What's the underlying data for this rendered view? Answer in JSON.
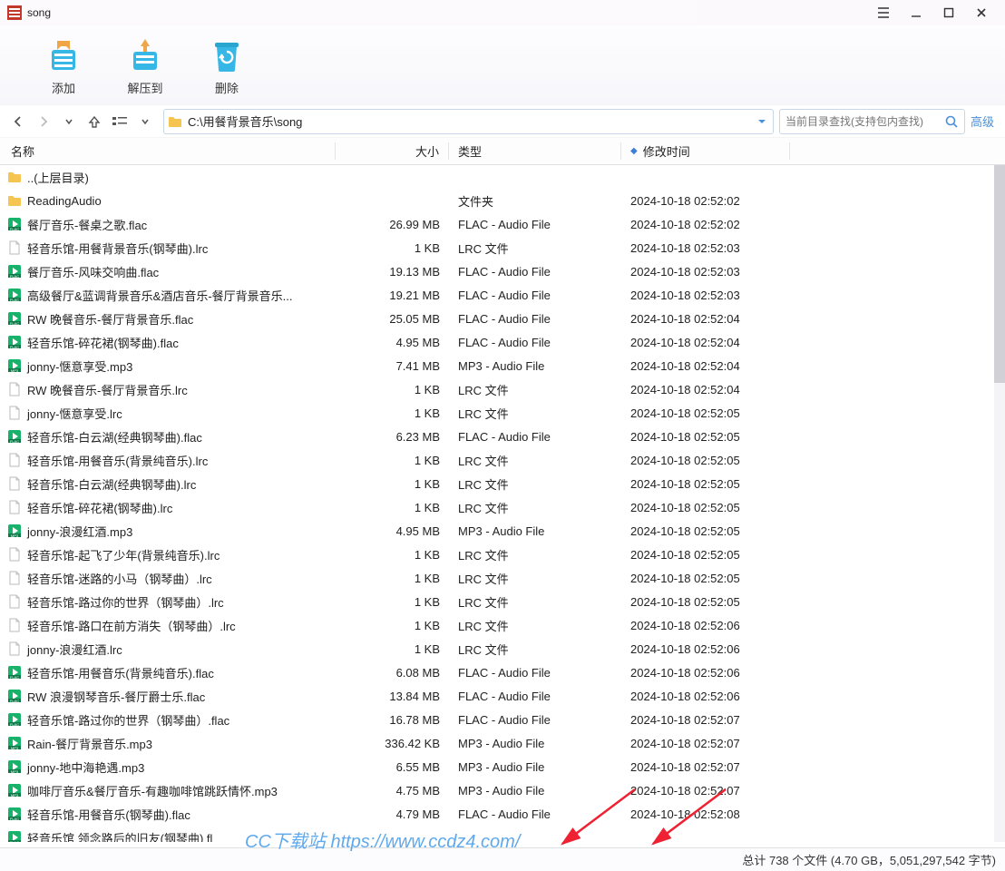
{
  "title": "song",
  "toolbar": {
    "add": "添加",
    "extract": "解压到",
    "delete": "删除"
  },
  "path": "C:\\用餐背景音乐\\song",
  "search_placeholder": "当前目录查找(支持包内查找)",
  "advanced": "高级",
  "columns": {
    "name": "名称",
    "size": "大小",
    "type": "类型",
    "date": "修改时间"
  },
  "files": [
    {
      "icon": "folder-up",
      "name": "..(上层目录)",
      "size": "",
      "type": "",
      "date": ""
    },
    {
      "icon": "folder",
      "name": "ReadingAudio",
      "size": "",
      "type": "文件夹",
      "date": "2024-10-18 02:52:02"
    },
    {
      "icon": "flac",
      "name": "餐厅音乐-餐桌之歌.flac",
      "size": "26.99 MB",
      "type": "FLAC - Audio File",
      "date": "2024-10-18 02:52:02"
    },
    {
      "icon": "lrc",
      "name": "轻音乐馆-用餐背景音乐(钢琴曲).lrc",
      "size": "1 KB",
      "type": "LRC 文件",
      "date": "2024-10-18 02:52:03"
    },
    {
      "icon": "flac",
      "name": "餐厅音乐-风味交响曲.flac",
      "size": "19.13 MB",
      "type": "FLAC - Audio File",
      "date": "2024-10-18 02:52:03"
    },
    {
      "icon": "flac",
      "name": "高级餐厅&蓝调背景音乐&酒店音乐-餐厅背景音乐...",
      "size": "19.21 MB",
      "type": "FLAC - Audio File",
      "date": "2024-10-18 02:52:03"
    },
    {
      "icon": "flac",
      "name": "RW 晚餐音乐-餐厅背景音乐.flac",
      "size": "25.05 MB",
      "type": "FLAC - Audio File",
      "date": "2024-10-18 02:52:04"
    },
    {
      "icon": "flac",
      "name": "轻音乐馆-碎花裙(钢琴曲).flac",
      "size": "4.95 MB",
      "type": "FLAC - Audio File",
      "date": "2024-10-18 02:52:04"
    },
    {
      "icon": "mp3",
      "name": "jonny-惬意享受.mp3",
      "size": "7.41 MB",
      "type": "MP3 - Audio File",
      "date": "2024-10-18 02:52:04"
    },
    {
      "icon": "lrc",
      "name": "RW 晚餐音乐-餐厅背景音乐.lrc",
      "size": "1 KB",
      "type": "LRC 文件",
      "date": "2024-10-18 02:52:04"
    },
    {
      "icon": "lrc",
      "name": "jonny-惬意享受.lrc",
      "size": "1 KB",
      "type": "LRC 文件",
      "date": "2024-10-18 02:52:05"
    },
    {
      "icon": "flac",
      "name": "轻音乐馆-白云湖(经典钢琴曲).flac",
      "size": "6.23 MB",
      "type": "FLAC - Audio File",
      "date": "2024-10-18 02:52:05"
    },
    {
      "icon": "lrc",
      "name": "轻音乐馆-用餐音乐(背景纯音乐).lrc",
      "size": "1 KB",
      "type": "LRC 文件",
      "date": "2024-10-18 02:52:05"
    },
    {
      "icon": "lrc",
      "name": "轻音乐馆-白云湖(经典钢琴曲).lrc",
      "size": "1 KB",
      "type": "LRC 文件",
      "date": "2024-10-18 02:52:05"
    },
    {
      "icon": "lrc",
      "name": "轻音乐馆-碎花裙(钢琴曲).lrc",
      "size": "1 KB",
      "type": "LRC 文件",
      "date": "2024-10-18 02:52:05"
    },
    {
      "icon": "mp3",
      "name": "jonny-浪漫红酒.mp3",
      "size": "4.95 MB",
      "type": "MP3 - Audio File",
      "date": "2024-10-18 02:52:05"
    },
    {
      "icon": "lrc",
      "name": "轻音乐馆-起飞了少年(背景纯音乐).lrc",
      "size": "1 KB",
      "type": "LRC 文件",
      "date": "2024-10-18 02:52:05"
    },
    {
      "icon": "lrc",
      "name": "轻音乐馆-迷路的小马（钢琴曲）.lrc",
      "size": "1 KB",
      "type": "LRC 文件",
      "date": "2024-10-18 02:52:05"
    },
    {
      "icon": "lrc",
      "name": "轻音乐馆-路过你的世界（钢琴曲）.lrc",
      "size": "1 KB",
      "type": "LRC 文件",
      "date": "2024-10-18 02:52:05"
    },
    {
      "icon": "lrc",
      "name": "轻音乐馆-路口在前方消失（钢琴曲）.lrc",
      "size": "1 KB",
      "type": "LRC 文件",
      "date": "2024-10-18 02:52:06"
    },
    {
      "icon": "lrc",
      "name": "jonny-浪漫红酒.lrc",
      "size": "1 KB",
      "type": "LRC 文件",
      "date": "2024-10-18 02:52:06"
    },
    {
      "icon": "flac",
      "name": "轻音乐馆-用餐音乐(背景纯音乐).flac",
      "size": "6.08 MB",
      "type": "FLAC - Audio File",
      "date": "2024-10-18 02:52:06"
    },
    {
      "icon": "flac",
      "name": "RW 浪漫钢琴音乐-餐厅爵士乐.flac",
      "size": "13.84 MB",
      "type": "FLAC - Audio File",
      "date": "2024-10-18 02:52:06"
    },
    {
      "icon": "flac",
      "name": "轻音乐馆-路过你的世界（钢琴曲）.flac",
      "size": "16.78 MB",
      "type": "FLAC - Audio File",
      "date": "2024-10-18 02:52:07"
    },
    {
      "icon": "mp3",
      "name": "Rain-餐厅背景音乐.mp3",
      "size": "336.42 KB",
      "type": "MP3 - Audio File",
      "date": "2024-10-18 02:52:07"
    },
    {
      "icon": "mp3",
      "name": "jonny-地中海艳遇.mp3",
      "size": "6.55 MB",
      "type": "MP3 - Audio File",
      "date": "2024-10-18 02:52:07"
    },
    {
      "icon": "mp3",
      "name": "咖啡厅音乐&餐厅音乐-有趣咖啡馆跳跃情怀.mp3",
      "size": "4.75 MB",
      "type": "MP3 - Audio File",
      "date": "2024-10-18 02:52:07"
    },
    {
      "icon": "flac",
      "name": "轻音乐馆-用餐音乐(钢琴曲).flac",
      "size": "4.79 MB",
      "type": "FLAC - Audio File",
      "date": "2024-10-18 02:52:08"
    },
    {
      "icon": "flac",
      "name": "轻音乐馆 领念路后的旧友(钢琴曲) fl",
      "size": "",
      "type": "",
      "date": ""
    }
  ],
  "status": "总计 738 个文件 (4.70 GB，5,051,297,542 字节)",
  "watermark": "CC下载站  https://www.ccdz4.com/"
}
